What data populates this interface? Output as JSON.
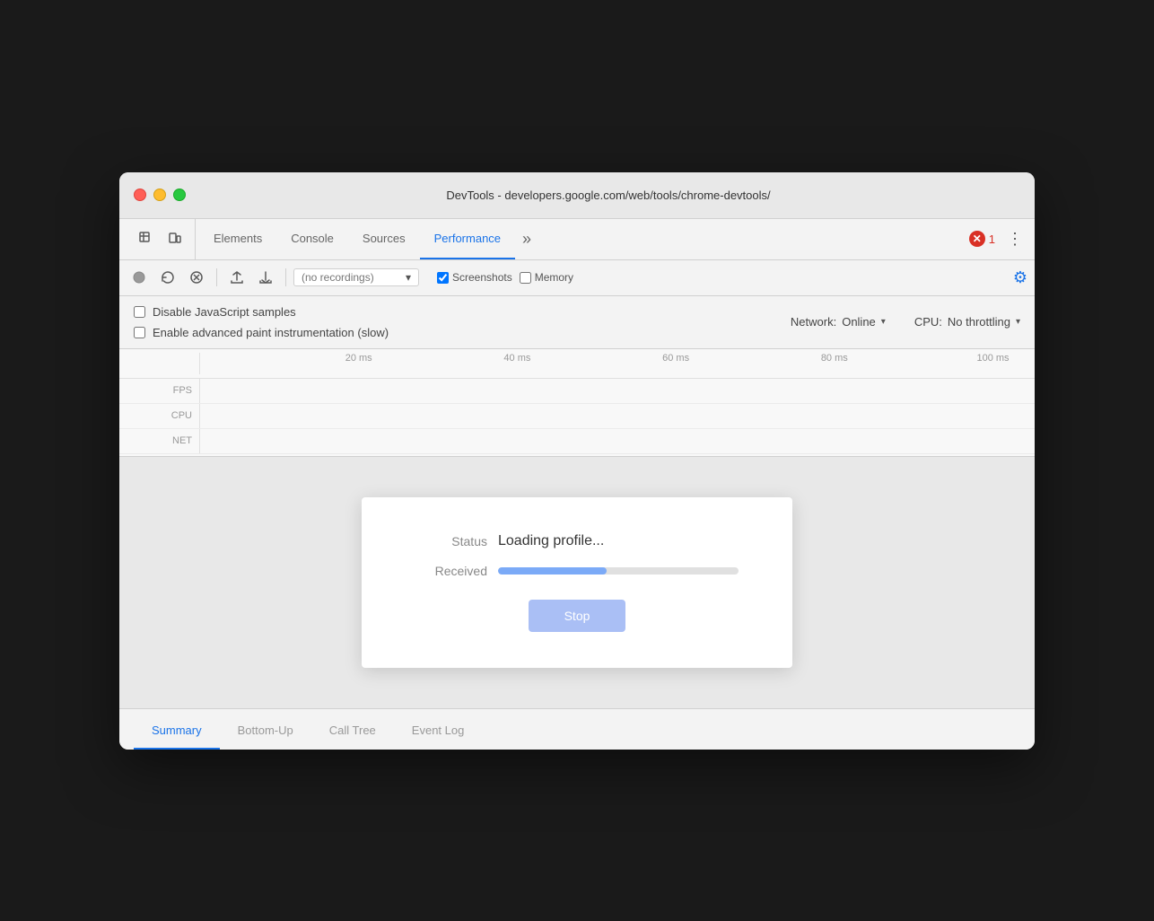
{
  "window": {
    "title": "DevTools - developers.google.com/web/tools/chrome-devtools/"
  },
  "tabs": {
    "items": [
      {
        "label": "Elements"
      },
      {
        "label": "Console"
      },
      {
        "label": "Sources"
      },
      {
        "label": "Performance"
      },
      {
        "label": "»"
      }
    ],
    "active": "Performance",
    "error_count": "1"
  },
  "toolbar": {
    "recording_placeholder": "(no recordings)",
    "screenshots_label": "Screenshots",
    "memory_label": "Memory"
  },
  "settings": {
    "disable_js_label": "Disable JavaScript samples",
    "enable_paint_label": "Enable advanced paint instrumentation (slow)",
    "network_label": "Network:",
    "network_value": "Online",
    "cpu_label": "CPU:",
    "cpu_value": "No throttling"
  },
  "timeline": {
    "ticks": [
      "20 ms",
      "40 ms",
      "60 ms",
      "80 ms",
      "100 ms"
    ],
    "fps_label": "FPS",
    "cpu_label": "CPU",
    "net_label": "NET"
  },
  "dialog": {
    "status_label": "Status",
    "status_value": "Loading profile...",
    "received_label": "Received",
    "progress_percent": 45,
    "stop_label": "Stop"
  },
  "bottom_tabs": {
    "items": [
      {
        "label": "Summary",
        "active": true
      },
      {
        "label": "Bottom-Up"
      },
      {
        "label": "Call Tree"
      },
      {
        "label": "Event Log"
      }
    ]
  }
}
